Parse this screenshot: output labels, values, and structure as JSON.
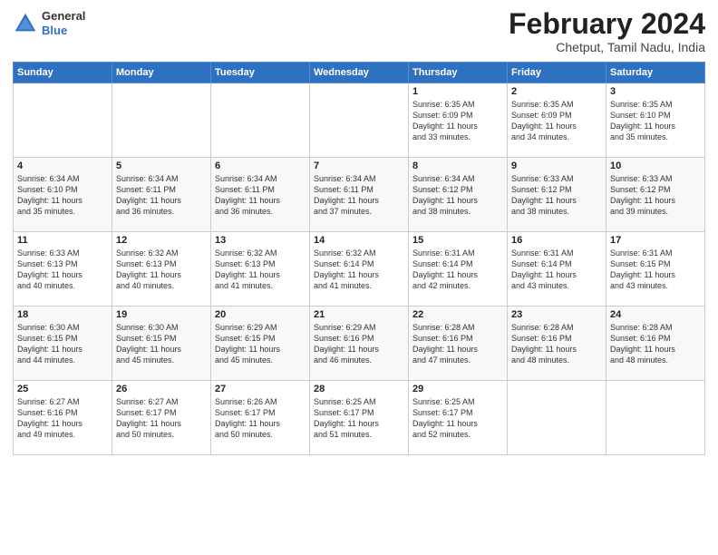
{
  "logo": {
    "general": "General",
    "blue": "Blue"
  },
  "header": {
    "month": "February 2024",
    "location": "Chetput, Tamil Nadu, India"
  },
  "weekdays": [
    "Sunday",
    "Monday",
    "Tuesday",
    "Wednesday",
    "Thursday",
    "Friday",
    "Saturday"
  ],
  "weeks": [
    [
      {
        "day": "",
        "info": ""
      },
      {
        "day": "",
        "info": ""
      },
      {
        "day": "",
        "info": ""
      },
      {
        "day": "",
        "info": ""
      },
      {
        "day": "1",
        "info": "Sunrise: 6:35 AM\nSunset: 6:09 PM\nDaylight: 11 hours\nand 33 minutes."
      },
      {
        "day": "2",
        "info": "Sunrise: 6:35 AM\nSunset: 6:09 PM\nDaylight: 11 hours\nand 34 minutes."
      },
      {
        "day": "3",
        "info": "Sunrise: 6:35 AM\nSunset: 6:10 PM\nDaylight: 11 hours\nand 35 minutes."
      }
    ],
    [
      {
        "day": "4",
        "info": "Sunrise: 6:34 AM\nSunset: 6:10 PM\nDaylight: 11 hours\nand 35 minutes."
      },
      {
        "day": "5",
        "info": "Sunrise: 6:34 AM\nSunset: 6:11 PM\nDaylight: 11 hours\nand 36 minutes."
      },
      {
        "day": "6",
        "info": "Sunrise: 6:34 AM\nSunset: 6:11 PM\nDaylight: 11 hours\nand 36 minutes."
      },
      {
        "day": "7",
        "info": "Sunrise: 6:34 AM\nSunset: 6:11 PM\nDaylight: 11 hours\nand 37 minutes."
      },
      {
        "day": "8",
        "info": "Sunrise: 6:34 AM\nSunset: 6:12 PM\nDaylight: 11 hours\nand 38 minutes."
      },
      {
        "day": "9",
        "info": "Sunrise: 6:33 AM\nSunset: 6:12 PM\nDaylight: 11 hours\nand 38 minutes."
      },
      {
        "day": "10",
        "info": "Sunrise: 6:33 AM\nSunset: 6:12 PM\nDaylight: 11 hours\nand 39 minutes."
      }
    ],
    [
      {
        "day": "11",
        "info": "Sunrise: 6:33 AM\nSunset: 6:13 PM\nDaylight: 11 hours\nand 40 minutes."
      },
      {
        "day": "12",
        "info": "Sunrise: 6:32 AM\nSunset: 6:13 PM\nDaylight: 11 hours\nand 40 minutes."
      },
      {
        "day": "13",
        "info": "Sunrise: 6:32 AM\nSunset: 6:13 PM\nDaylight: 11 hours\nand 41 minutes."
      },
      {
        "day": "14",
        "info": "Sunrise: 6:32 AM\nSunset: 6:14 PM\nDaylight: 11 hours\nand 41 minutes."
      },
      {
        "day": "15",
        "info": "Sunrise: 6:31 AM\nSunset: 6:14 PM\nDaylight: 11 hours\nand 42 minutes."
      },
      {
        "day": "16",
        "info": "Sunrise: 6:31 AM\nSunset: 6:14 PM\nDaylight: 11 hours\nand 43 minutes."
      },
      {
        "day": "17",
        "info": "Sunrise: 6:31 AM\nSunset: 6:15 PM\nDaylight: 11 hours\nand 43 minutes."
      }
    ],
    [
      {
        "day": "18",
        "info": "Sunrise: 6:30 AM\nSunset: 6:15 PM\nDaylight: 11 hours\nand 44 minutes."
      },
      {
        "day": "19",
        "info": "Sunrise: 6:30 AM\nSunset: 6:15 PM\nDaylight: 11 hours\nand 45 minutes."
      },
      {
        "day": "20",
        "info": "Sunrise: 6:29 AM\nSunset: 6:15 PM\nDaylight: 11 hours\nand 45 minutes."
      },
      {
        "day": "21",
        "info": "Sunrise: 6:29 AM\nSunset: 6:16 PM\nDaylight: 11 hours\nand 46 minutes."
      },
      {
        "day": "22",
        "info": "Sunrise: 6:28 AM\nSunset: 6:16 PM\nDaylight: 11 hours\nand 47 minutes."
      },
      {
        "day": "23",
        "info": "Sunrise: 6:28 AM\nSunset: 6:16 PM\nDaylight: 11 hours\nand 48 minutes."
      },
      {
        "day": "24",
        "info": "Sunrise: 6:28 AM\nSunset: 6:16 PM\nDaylight: 11 hours\nand 48 minutes."
      }
    ],
    [
      {
        "day": "25",
        "info": "Sunrise: 6:27 AM\nSunset: 6:16 PM\nDaylight: 11 hours\nand 49 minutes."
      },
      {
        "day": "26",
        "info": "Sunrise: 6:27 AM\nSunset: 6:17 PM\nDaylight: 11 hours\nand 50 minutes."
      },
      {
        "day": "27",
        "info": "Sunrise: 6:26 AM\nSunset: 6:17 PM\nDaylight: 11 hours\nand 50 minutes."
      },
      {
        "day": "28",
        "info": "Sunrise: 6:25 AM\nSunset: 6:17 PM\nDaylight: 11 hours\nand 51 minutes."
      },
      {
        "day": "29",
        "info": "Sunrise: 6:25 AM\nSunset: 6:17 PM\nDaylight: 11 hours\nand 52 minutes."
      },
      {
        "day": "",
        "info": ""
      },
      {
        "day": "",
        "info": ""
      }
    ]
  ]
}
